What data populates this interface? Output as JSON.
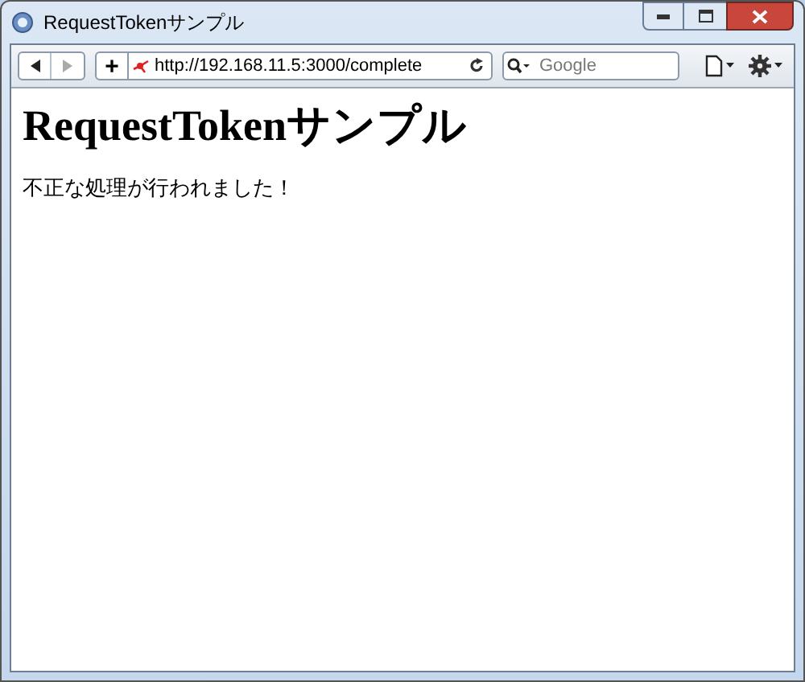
{
  "window": {
    "title": "RequestTokenサンプル"
  },
  "toolbar": {
    "plus": "+",
    "address": "http://192.168.11.5:3000/complete",
    "search": {
      "placeholder": "Google"
    }
  },
  "page": {
    "heading": "RequestTokenサンプル",
    "message": "不正な処理が行われました！"
  }
}
